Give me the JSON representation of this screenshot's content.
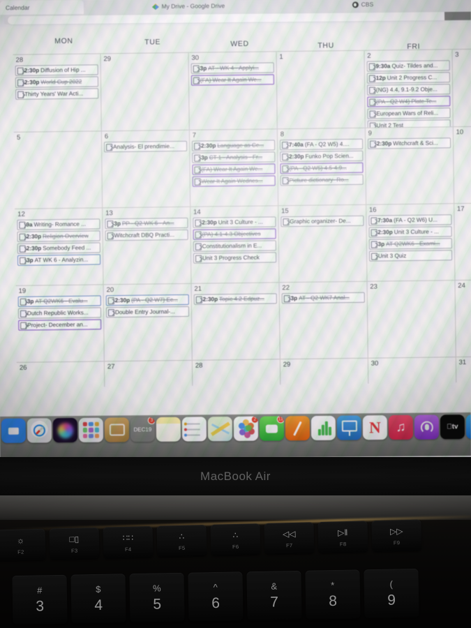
{
  "browser": {
    "tabs": [
      {
        "label": "Calendar",
        "icon": "calendar-icon",
        "active": true
      },
      {
        "label": "My Drive - Google Drive",
        "icon": "google-drive-icon",
        "active": false
      },
      {
        "label": "CBS",
        "icon": "cbs-eye-icon",
        "active": false
      }
    ]
  },
  "calendar": {
    "day_headers": [
      "MON",
      "TUE",
      "WED",
      "THU",
      "FRI"
    ],
    "weeks": [
      {
        "days": [
          {
            "num": "28",
            "events": [
              {
                "time": "2:30p",
                "title": "Diffusion of Hip ...",
                "struck": false,
                "style": "plain"
              },
              {
                "time": "2:30p",
                "title": "World Cup 2022",
                "struck": true,
                "style": "plain"
              },
              {
                "time": "",
                "title": "Thirty Years' War Acti...",
                "struck": false,
                "style": "plain"
              }
            ]
          },
          {
            "num": "29",
            "events": []
          },
          {
            "num": "30",
            "events": [
              {
                "time": "3p",
                "title": "AT - WK 4 - Applyi...",
                "struck": true,
                "style": "plain"
              },
              {
                "time": "",
                "title": "(FA) Wear It Again We...",
                "struck": true,
                "style": "purple"
              }
            ]
          },
          {
            "num": "1",
            "events": []
          },
          {
            "num": "2",
            "events": [
              {
                "time": "9:30a",
                "title": "Quiz- Tildes and...",
                "struck": false,
                "style": "plain"
              },
              {
                "time": "12p",
                "title": "Unit 2 Progress C...",
                "struck": false,
                "style": "plain"
              },
              {
                "time": "",
                "title": "(NG) 4.4, 9.1-9.2 Obje...",
                "struck": false,
                "style": "plain"
              },
              {
                "time": "",
                "title": "(PA - Q2 W4) Plate Te...",
                "struck": true,
                "style": "purple"
              },
              {
                "time": "",
                "title": "European Wars of Reli...",
                "struck": false,
                "style": "plain"
              },
              {
                "time": "",
                "title": "Unit 2 Test",
                "struck": false,
                "style": "plain"
              }
            ]
          },
          {
            "num": "3",
            "events": []
          }
        ]
      },
      {
        "days": [
          {
            "num": "5",
            "events": []
          },
          {
            "num": "6",
            "events": [
              {
                "time": "",
                "title": "Analysis- El prendimie...",
                "struck": false,
                "style": "plain"
              }
            ]
          },
          {
            "num": "7",
            "events": [
              {
                "time": "2:30p",
                "title": "Language as Ce...",
                "struck": true,
                "style": "plain"
              },
              {
                "time": "3p",
                "title": "CT 1 - Analysis - Fr...",
                "struck": true,
                "style": "plain"
              },
              {
                "time": "",
                "title": "(FA) Wear It Again We...",
                "struck": true,
                "style": "purple"
              },
              {
                "time": "",
                "title": "Wear It Again Wednes...",
                "struck": true,
                "style": "purple"
              }
            ]
          },
          {
            "num": "8",
            "events": [
              {
                "time": "7:40a",
                "title": "(FA - Q2 W5) 4....",
                "struck": false,
                "style": "plain"
              },
              {
                "time": "2:30p",
                "title": "Funko Pop Scien...",
                "struck": false,
                "style": "plain"
              },
              {
                "time": "",
                "title": "(PA - Q2 W5) 4.5-4.9...",
                "struck": true,
                "style": "purple"
              },
              {
                "time": "",
                "title": "Picture dictionary- Ro...",
                "struck": true,
                "style": "plain"
              }
            ]
          },
          {
            "num": "9",
            "events": [
              {
                "time": "2:30p",
                "title": "Witchcraft & Sci...",
                "struck": false,
                "style": "plain"
              }
            ]
          },
          {
            "num": "10",
            "events": []
          }
        ]
      },
      {
        "days": [
          {
            "num": "12",
            "events": [
              {
                "time": "9a",
                "title": "Writing- Romance ...",
                "struck": false,
                "style": "plain"
              },
              {
                "time": "2:30p",
                "title": "Religion Overview",
                "struck": true,
                "style": "plain"
              },
              {
                "time": "2:30p",
                "title": "Somebody Feed ...",
                "struck": false,
                "style": "plain"
              },
              {
                "time": "3p",
                "title": "AT WK 6 - Analyzin...",
                "struck": false,
                "style": "blue"
              }
            ]
          },
          {
            "num": "13",
            "events": [
              {
                "time": "3p",
                "title": "PP - Q2 WK 6 - An...",
                "struck": true,
                "style": "plain"
              },
              {
                "time": "",
                "title": "Witchcraft DBQ Practi...",
                "struck": false,
                "style": "plain"
              }
            ]
          },
          {
            "num": "14",
            "events": [
              {
                "time": "2:30p",
                "title": "Unit 3 Culture - ...",
                "struck": false,
                "style": "plain"
              },
              {
                "time": "",
                "title": "(PA) 4.1-4.3 Objectives",
                "struck": true,
                "style": "purple"
              },
              {
                "time": "",
                "title": "Constitutionalism in E...",
                "struck": false,
                "style": "plain"
              },
              {
                "time": "",
                "title": "Unit 3 Progress Check",
                "struck": false,
                "style": "plain"
              }
            ]
          },
          {
            "num": "15",
            "events": [
              {
                "time": "",
                "title": "Graphic organizer- De...",
                "struck": false,
                "style": "plain"
              }
            ]
          },
          {
            "num": "16",
            "events": [
              {
                "time": "7:30a",
                "title": "(FA - Q2 W6) U...",
                "struck": false,
                "style": "plain"
              },
              {
                "time": "2:30p",
                "title": "Unit 3 Culture - ...",
                "struck": false,
                "style": "plain"
              },
              {
                "time": "3p",
                "title": "AT Q2WK6 - Exami...",
                "struck": true,
                "style": "plain"
              },
              {
                "time": "",
                "title": "Unit 3 Quiz",
                "struck": false,
                "style": "plain"
              }
            ]
          },
          {
            "num": "17",
            "events": []
          }
        ]
      },
      {
        "days": [
          {
            "num": "19",
            "events": [
              {
                "time": "3p",
                "title": "AT Q2WK6 - Evalu...",
                "struck": true,
                "style": "blue"
              },
              {
                "time": "",
                "title": "Dutch Republic Works...",
                "struck": false,
                "style": "plain"
              },
              {
                "time": "",
                "title": "Project- December an...",
                "struck": false,
                "style": "purple"
              }
            ]
          },
          {
            "num": "20",
            "events": [
              {
                "time": "2:30p",
                "title": "(PA - Q2 W7) Ec...",
                "struck": true,
                "style": "blue"
              },
              {
                "time": "",
                "title": "Double Entry Journal-...",
                "struck": false,
                "style": "plain"
              }
            ]
          },
          {
            "num": "21",
            "events": [
              {
                "time": "2:30p",
                "title": "Topic 4.2 Edpuz...",
                "struck": true,
                "style": "plain"
              }
            ]
          },
          {
            "num": "22",
            "events": [
              {
                "time": "3p",
                "title": "AT - Q2 WK7 Anal...",
                "struck": true,
                "style": "plain"
              }
            ]
          },
          {
            "num": "23",
            "events": []
          },
          {
            "num": "24",
            "events": []
          }
        ]
      },
      {
        "days": [
          {
            "num": "26",
            "events": []
          },
          {
            "num": "27",
            "events": []
          },
          {
            "num": "28",
            "events": []
          },
          {
            "num": "29",
            "events": []
          },
          {
            "num": "30",
            "events": []
          },
          {
            "num": "31",
            "events": []
          }
        ]
      }
    ]
  },
  "dock": {
    "apps": [
      {
        "name": "zoom",
        "label": ""
      },
      {
        "name": "safari",
        "label": ""
      },
      {
        "name": "siri",
        "label": ""
      },
      {
        "name": "launchpad",
        "label": ""
      },
      {
        "name": "mail",
        "label": ""
      },
      {
        "name": "calendar",
        "label": "",
        "month": "DEC",
        "day": "19",
        "badge": "3"
      },
      {
        "name": "notes",
        "label": ""
      },
      {
        "name": "reminders",
        "label": ""
      },
      {
        "name": "maps",
        "label": ""
      },
      {
        "name": "photos",
        "label": "",
        "badge": "2"
      },
      {
        "name": "facetime",
        "label": "",
        "badge": "11"
      },
      {
        "name": "pages",
        "label": ""
      },
      {
        "name": "numbers",
        "label": ""
      },
      {
        "name": "keynote",
        "label": ""
      },
      {
        "name": "news",
        "label": ""
      },
      {
        "name": "music",
        "label": ""
      },
      {
        "name": "podcasts",
        "label": ""
      },
      {
        "name": "appletv",
        "label": ""
      },
      {
        "name": "appstore",
        "label": ""
      },
      {
        "name": "systempreferences",
        "label": ""
      }
    ]
  },
  "laptop": {
    "brand": "MacBook Air",
    "function_keys": [
      {
        "fname": "F2",
        "glyph": "☼"
      },
      {
        "fname": "F3",
        "glyph": "□▯"
      },
      {
        "fname": "F4",
        "glyph": "∷∷"
      },
      {
        "fname": "F5",
        "glyph": "∴"
      },
      {
        "fname": "F6",
        "glyph": "∴"
      },
      {
        "fname": "F7",
        "glyph": "◁◁"
      },
      {
        "fname": "F8",
        "glyph": "▷‖"
      },
      {
        "fname": "F9",
        "glyph": "▷▷"
      }
    ],
    "number_keys": [
      {
        "sym": "#",
        "num": "3"
      },
      {
        "sym": "$",
        "num": "4"
      },
      {
        "sym": "%",
        "num": "5"
      },
      {
        "sym": "^",
        "num": "6"
      },
      {
        "sym": "&",
        "num": "7"
      },
      {
        "sym": "*",
        "num": "8"
      },
      {
        "sym": "(",
        "num": "9"
      }
    ]
  }
}
